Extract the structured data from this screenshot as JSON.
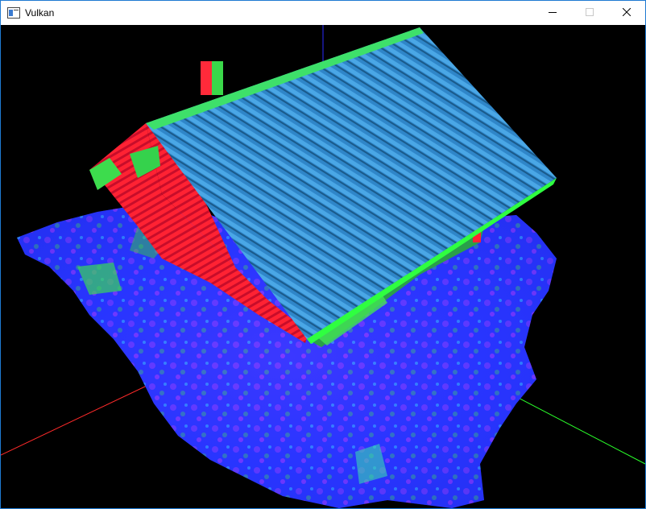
{
  "window": {
    "title": "Vulkan",
    "icons": {
      "app": "app-window-icon",
      "minimize": "minimize-icon",
      "maximize": "maximize-icon",
      "close": "close-icon"
    }
  },
  "scene": {
    "description_colors": {
      "ground": "#2a38ff",
      "roof": "#2f86c9",
      "walls": "#ff2a3a",
      "highlights": "#1fff3f",
      "axis_x": "#ff2a2a",
      "axis_y": "#2aff2a",
      "axis_z": "#2a2aff"
    }
  }
}
